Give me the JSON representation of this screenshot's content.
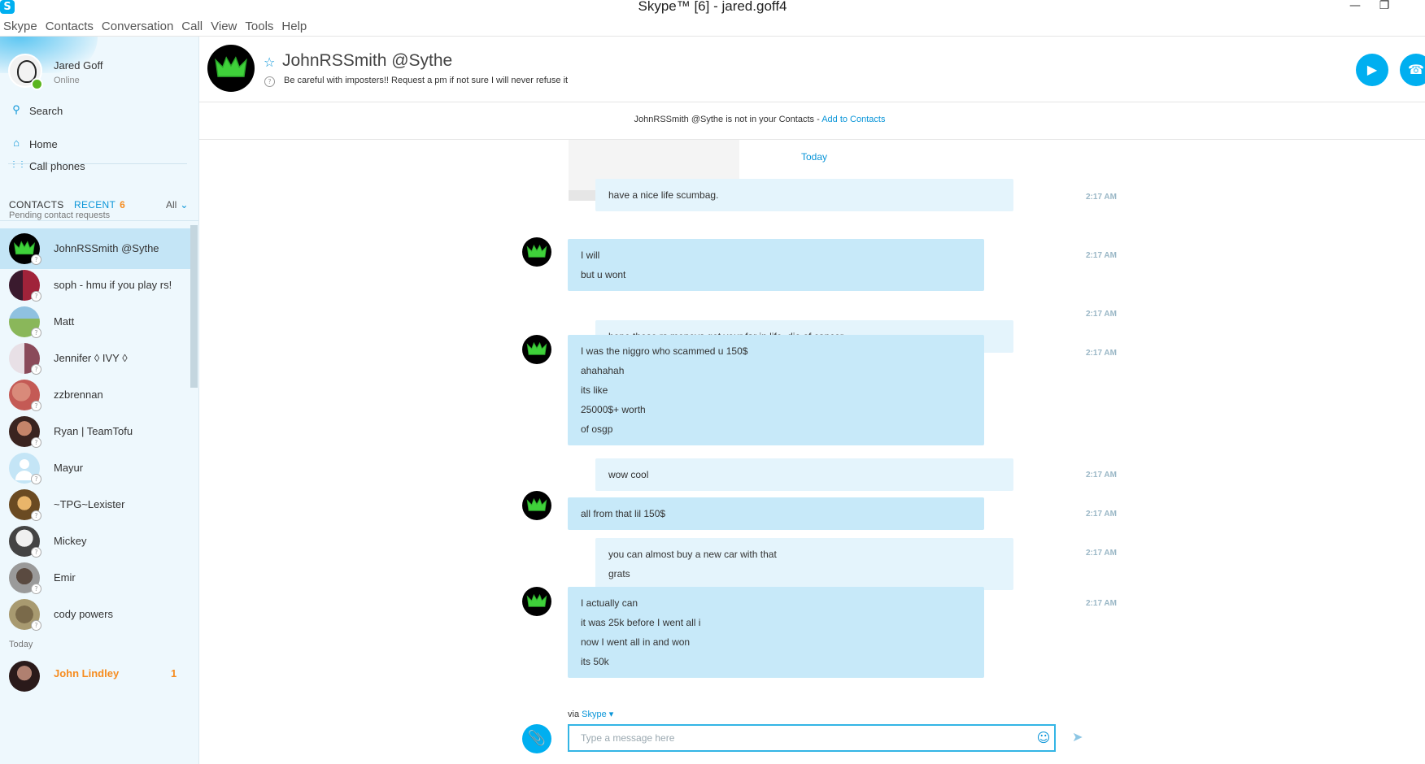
{
  "window": {
    "title": "Skype™ [6] - jared.goff4",
    "logo": "S"
  },
  "menu": [
    "Skype",
    "Contacts",
    "Conversation",
    "Call",
    "View",
    "Tools",
    "Help"
  ],
  "me": {
    "name": "Jared Goff",
    "status": "Online"
  },
  "nav": {
    "search": "Search",
    "home": "Home",
    "call_phones": "Call phones"
  },
  "tabs": {
    "contacts": "CONTACTS",
    "recent": "RECENT",
    "recent_count": "6",
    "filter": "All"
  },
  "sections": {
    "pending": "Pending contact requests",
    "today": "Today"
  },
  "contacts": [
    {
      "name": "JohnRSSmith @Sythe"
    },
    {
      "name": "soph - hmu if you play rs!"
    },
    {
      "name": "Matt"
    },
    {
      "name": "Jennifer ◊ IVY ◊"
    },
    {
      "name": "zzbrennan"
    },
    {
      "name": "Ryan | TeamTofu"
    },
    {
      "name": "Mayur"
    },
    {
      "name": "~TPG~Lexister"
    },
    {
      "name": "Mickey"
    },
    {
      "name": "Emir"
    },
    {
      "name": "cody powers"
    }
  ],
  "today_contacts": [
    {
      "name": "John Lindley",
      "badge": "1"
    }
  ],
  "conversation": {
    "name": "JohnRSSmith @Sythe",
    "mood": "Be careful with imposters!! Request a pm if not sure I will never refuse it",
    "notice_text": "JohnRSSmith @Sythe is not in your Contacts - ",
    "notice_link": "Add to Contacts",
    "date_separator": "Today"
  },
  "messages": [
    {
      "from": "me",
      "lines": [
        "have a nice life scumbag."
      ],
      "time": "2:17 AM"
    },
    {
      "from": "them",
      "lines": [
        "I will",
        "but u wont"
      ],
      "time": "2:17 AM"
    },
    {
      "from": "me",
      "lines": [
        "hope those rs moneys get your far in life, die of cancer"
      ],
      "time": "2:17 AM"
    },
    {
      "from": "them",
      "lines": [
        "I was the niggro who scammed u 150$",
        "ahahahah",
        "its like",
        "25000$+ worth",
        "of osgp"
      ],
      "time": "2:17 AM"
    },
    {
      "from": "me",
      "lines": [
        "wow cool"
      ],
      "time": "2:17 AM"
    },
    {
      "from": "them",
      "lines": [
        "all from that lil 150$"
      ],
      "time": "2:17 AM"
    },
    {
      "from": "me",
      "lines": [
        "you can almost buy a new car with that",
        "grats"
      ],
      "time": "2:17 AM"
    },
    {
      "from": "them",
      "lines": [
        "I actually can",
        "it was 25k before I went all i",
        "now I went all in and won",
        "its 50k"
      ],
      "time": "2:17 AM"
    }
  ],
  "composer": {
    "via": "via",
    "via_brand": "Skype",
    "placeholder": "Type a message here"
  },
  "icons": {
    "search": "search-icon",
    "home": "home-icon",
    "dialpad": "dialpad-icon",
    "video_call": "video-call-icon",
    "audio_call": "phone-icon",
    "attach": "paperclip-icon",
    "emoji": "emoticon-icon",
    "send": "send-icon"
  },
  "colors": {
    "accent": "#00aff0",
    "link": "#0a95d8",
    "unread": "#f68c1f",
    "online": "#5bb51e",
    "bubble_in": "#c7e9f9",
    "bubble_out": "#e4f4fc"
  }
}
